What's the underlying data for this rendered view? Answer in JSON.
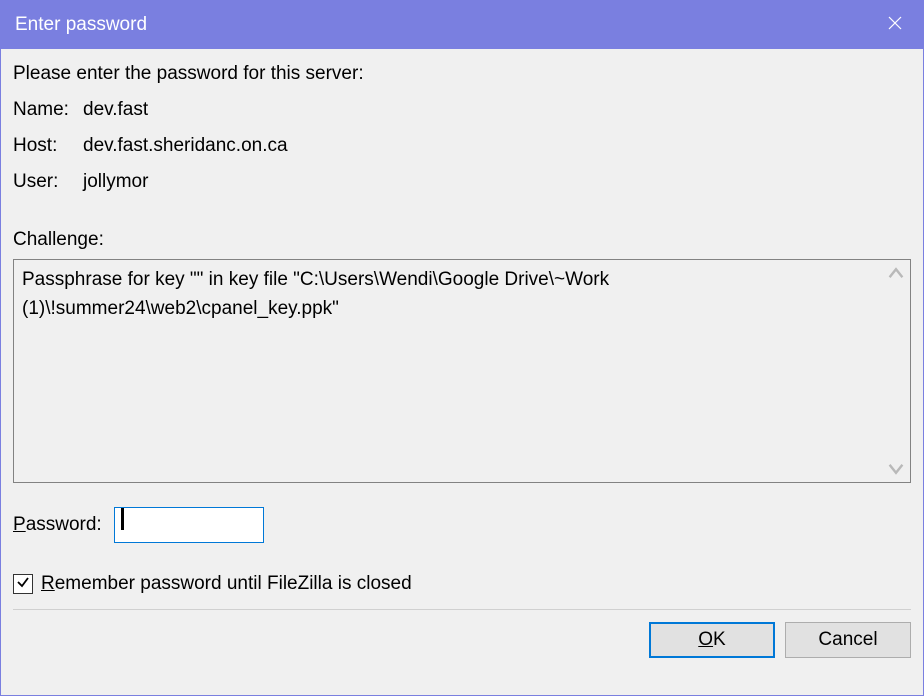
{
  "titlebar": {
    "title": "Enter password"
  },
  "prompt": "Please enter the password for this server:",
  "info": {
    "name_label": "Name:",
    "name_value": "dev.fast",
    "host_label": "Host:",
    "host_value": "dev.fast.sheridanc.on.ca",
    "user_label": "User:",
    "user_value": "jollymor"
  },
  "challenge": {
    "label": "Challenge:",
    "text": "Passphrase for key \"\" in key file \"C:\\Users\\Wendi\\Google Drive\\~Work (1)\\!summer24\\web2\\cpanel_key.ppk\""
  },
  "password": {
    "label_pre": "P",
    "label_rest": "assword:",
    "value": ""
  },
  "remember": {
    "checked": true,
    "label_pre": "R",
    "label_rest": "emember password until FileZilla is closed"
  },
  "buttons": {
    "ok_pre": "O",
    "ok_rest": "K",
    "cancel": "Cancel"
  }
}
